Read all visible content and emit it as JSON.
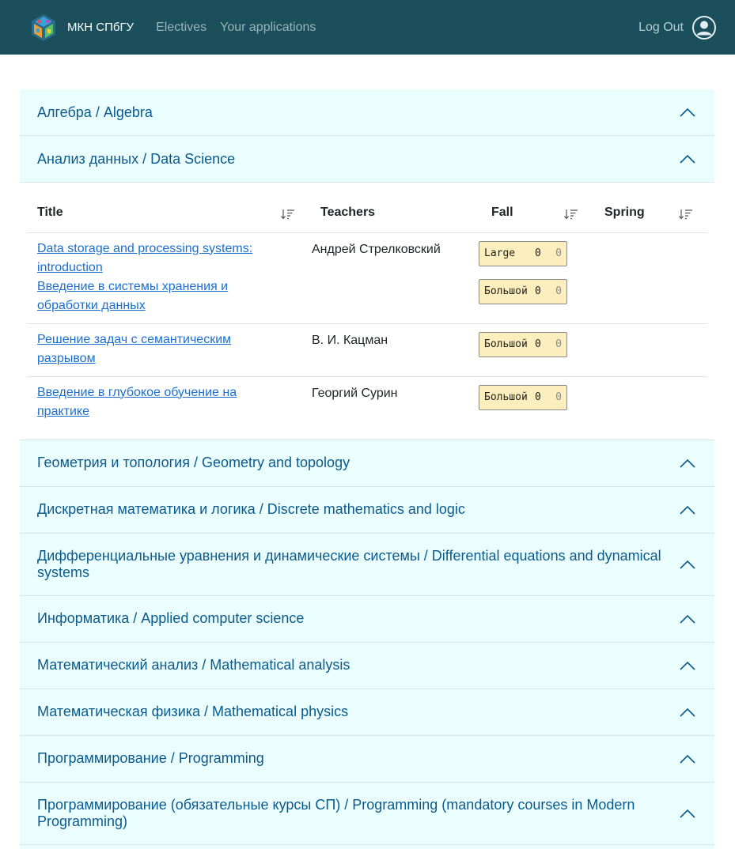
{
  "nav": {
    "brand": "МКН СПбГУ",
    "links": [
      "Electives",
      "Your applications"
    ],
    "logout": "Log Out"
  },
  "sections": [
    {
      "title": "Алгебра / Algebra"
    },
    {
      "title": "Анализ данных / Data Science"
    },
    {
      "title": "Геометрия и топология / Geometry and topology"
    },
    {
      "title": "Дискретная математика и логика / Discrete mathematics and logic"
    },
    {
      "title": "Дифференциальные уравнения и динамические системы / Differential equations and dynamical systems"
    },
    {
      "title": "Информатика / Applied computer science"
    },
    {
      "title": "Математический анализ / Mathematical analysis"
    },
    {
      "title": "Математическая физика / Mathematical physics"
    },
    {
      "title": "Программирование / Programming"
    },
    {
      "title": "Программирование (обязательные курсы СП) / Programming (mandatory courses in Modern Programming)"
    }
  ],
  "table": {
    "headers": {
      "title": "Title",
      "teachers": "Teachers",
      "fall": "Fall",
      "spring": "Spring"
    },
    "rows": [
      {
        "titles": [
          "Data storage and processing systems: introduction",
          "Введение в системы хранения и обработки данных"
        ],
        "teacher": "Андрей Стрелковский",
        "fall": [
          {
            "label": "Large",
            "n1": "0",
            "n2": "0"
          },
          {
            "label": "Большой",
            "n1": "0",
            "n2": "0"
          }
        ]
      },
      {
        "titles": [
          "Решение задач с семантическим разрывом"
        ],
        "teacher": "В. И. Кацман",
        "fall": [
          {
            "label": "Большой",
            "n1": "0",
            "n2": "0"
          }
        ]
      },
      {
        "titles": [
          "Введение в глубокое обучение на практике"
        ],
        "teacher": "Георгий Сурин",
        "fall": [
          {
            "label": "Большой",
            "n1": "0",
            "n2": "0"
          }
        ]
      }
    ]
  },
  "icons": {
    "logo": "cube-logo-icon",
    "user": "user-circle-icon",
    "chevron": "chevron-up-icon",
    "sort": "sort-descending-icon"
  },
  "colors": {
    "navbar": "#1b4f5c",
    "section_bg": "#ebfefe",
    "section_text": "#0b5a8e",
    "link": "#1a6fd1",
    "badge_bg": "#fcefbd"
  }
}
